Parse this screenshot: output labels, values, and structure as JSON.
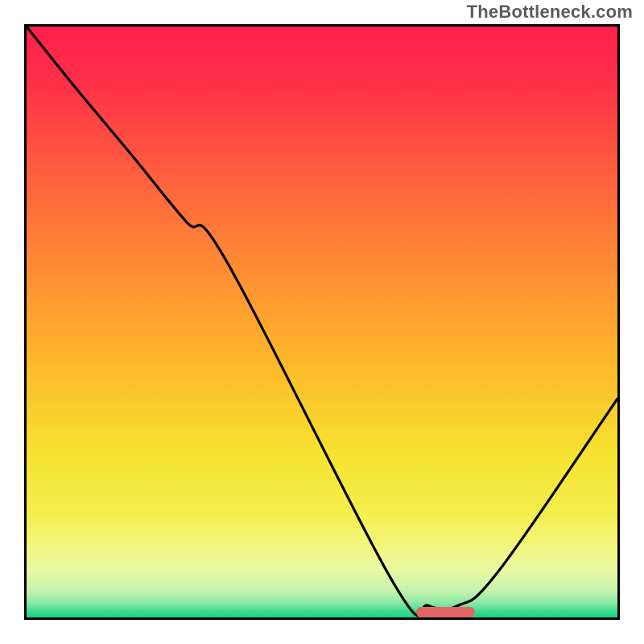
{
  "watermark": "TheBottleneck.com",
  "chart_data": {
    "type": "line",
    "title": "",
    "xlabel": "",
    "ylabel": "",
    "xlim": [
      0,
      100
    ],
    "ylim": [
      0,
      100
    ],
    "legend": false,
    "grid": false,
    "annotations": [
      "bottleneck-marker"
    ],
    "series": [
      {
        "name": "bottleneck-curve",
        "x": [
          0,
          8,
          18,
          27,
          34,
          62,
          68,
          73,
          80,
          100
        ],
        "values": [
          100,
          90,
          78,
          67,
          60,
          6,
          2,
          2,
          8,
          37
        ]
      }
    ],
    "marker": {
      "x_start": 66,
      "x_end": 76,
      "y": 0,
      "color": "#e06666"
    },
    "gradient_stops": [
      {
        "pct": 0,
        "color": "#ff1f4c"
      },
      {
        "pct": 10,
        "color": "#ff3148"
      },
      {
        "pct": 25,
        "color": "#ff5f3e"
      },
      {
        "pct": 42,
        "color": "#ff8f33"
      },
      {
        "pct": 58,
        "color": "#fdbb2a"
      },
      {
        "pct": 72,
        "color": "#f6e22f"
      },
      {
        "pct": 82,
        "color": "#f4ee4c"
      },
      {
        "pct": 88,
        "color": "#f3f67e"
      },
      {
        "pct": 92,
        "color": "#e8f9a2"
      },
      {
        "pct": 95.5,
        "color": "#c7f3ad"
      },
      {
        "pct": 97.5,
        "color": "#8be9a6"
      },
      {
        "pct": 99,
        "color": "#3bdc8f"
      },
      {
        "pct": 100,
        "color": "#1bd381"
      }
    ]
  }
}
